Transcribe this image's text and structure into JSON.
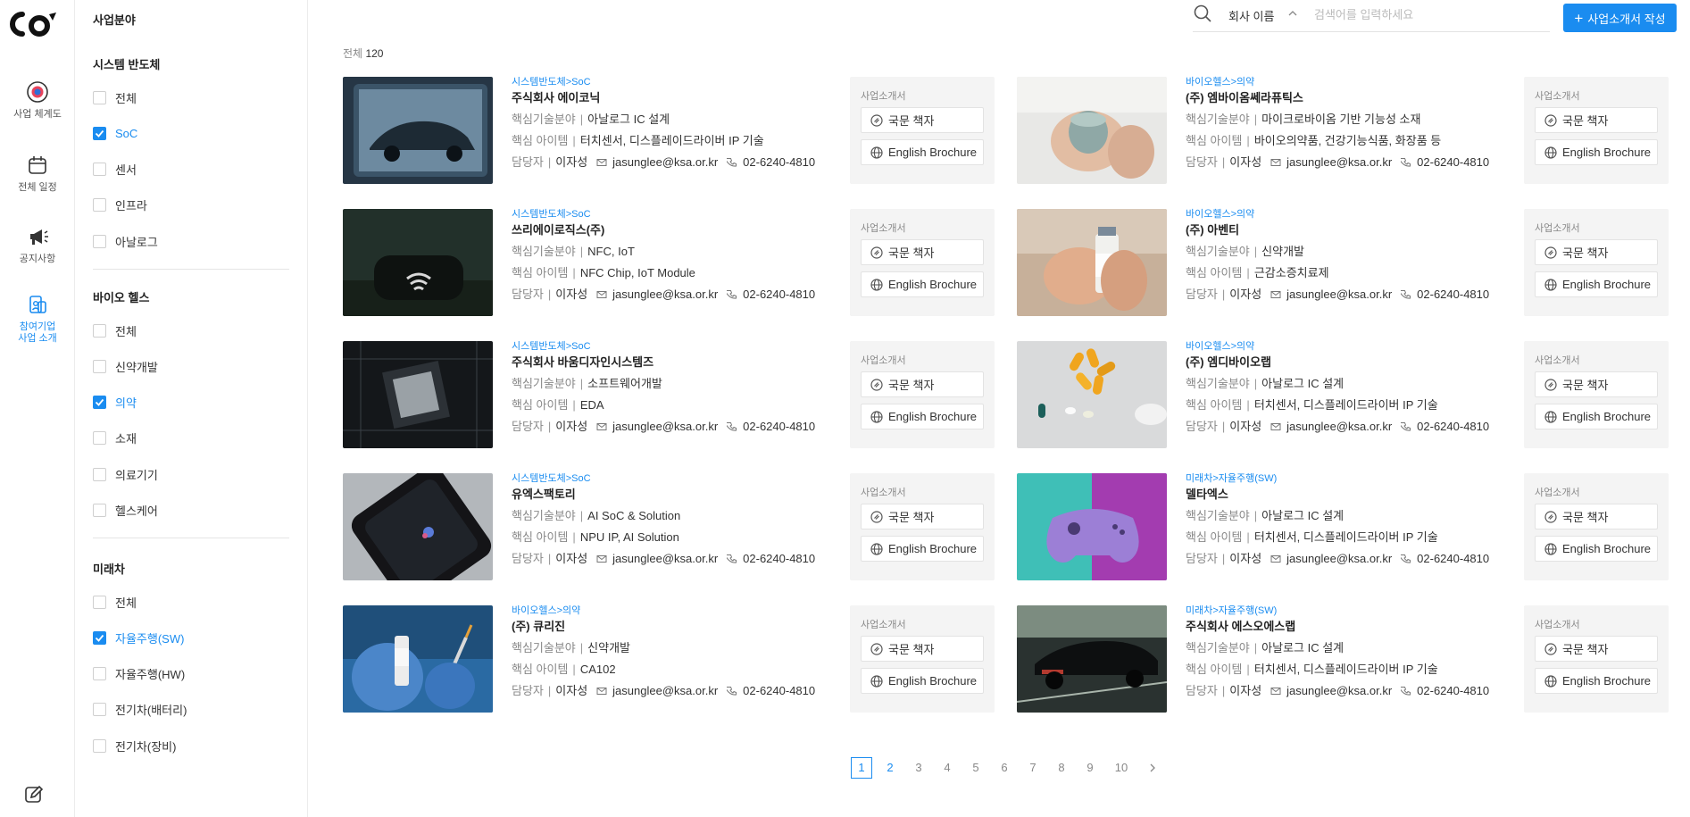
{
  "rail": {
    "items": [
      {
        "label": "사업 체계도",
        "icon": "badge-icon"
      },
      {
        "label": "전체 일정",
        "icon": "calendar-icon"
      },
      {
        "label": "공지사항",
        "icon": "megaphone-icon"
      },
      {
        "label": "참여기업\n사업 소개",
        "icon": "building-icon"
      }
    ],
    "bottom_icon": "edit-icon"
  },
  "filters": {
    "title": "사업분야",
    "groups": [
      {
        "title": "시스템 반도체",
        "items": [
          {
            "label": "전체",
            "checked": false
          },
          {
            "label": "SoC",
            "checked": true
          },
          {
            "label": "센서",
            "checked": false
          },
          {
            "label": "인프라",
            "checked": false
          },
          {
            "label": "아날로그",
            "checked": false
          }
        ]
      },
      {
        "title": "바이오 헬스",
        "items": [
          {
            "label": "전체",
            "checked": false
          },
          {
            "label": "신약개발",
            "checked": false
          },
          {
            "label": "의약",
            "checked": true
          },
          {
            "label": "소재",
            "checked": false
          },
          {
            "label": "의료기기",
            "checked": false
          },
          {
            "label": "헬스케어",
            "checked": false
          }
        ]
      },
      {
        "title": "미래차",
        "items": [
          {
            "label": "전체",
            "checked": false
          },
          {
            "label": "자율주행(SW)",
            "checked": true
          },
          {
            "label": "자율주행(HW)",
            "checked": false
          },
          {
            "label": "전기차(배터리)",
            "checked": false
          },
          {
            "label": "전기차(장비)",
            "checked": false
          }
        ]
      }
    ]
  },
  "search": {
    "field": "회사 이름",
    "placeholder": "검색어를 입력하세요"
  },
  "write_button": "사업소개서 작성",
  "total": {
    "label": "전체",
    "count": "120"
  },
  "labels": {
    "tech": "핵심기술분야",
    "item": "핵심 아이템",
    "manager": "담당자",
    "brochure_title": "사업소개서",
    "korean": "국문 책자",
    "english": "English Brochure"
  },
  "companies": [
    {
      "category": "시스템반도체>SoC",
      "name": "주식회사 에이코닉",
      "tech": "아날로그 IC 설계",
      "item": "터치센서, 디스플레이드라이버 IP 기술",
      "manager": "이자성",
      "email": "jasunglee@ksa.or.kr",
      "phone": "02-6240-4810",
      "thumb": "tablet-car"
    },
    {
      "category": "바이오헬스>의약",
      "name": "(주) 엠바이옴쎄라퓨틱스",
      "tech": "마이크로바이옴 기반 기능성 소재",
      "item": "바이오의약품, 건강기능식품, 화장품 등",
      "manager": "이자성",
      "email": "jasunglee@ksa.or.kr",
      "phone": "02-6240-4810",
      "thumb": "hands-jar"
    },
    {
      "category": "시스템반도체>SoC",
      "name": "쓰리에이로직스(주)",
      "tech": "NFC, IoT",
      "item": "NFC Chip, IoT Module",
      "manager": "이자성",
      "email": "jasunglee@ksa.or.kr",
      "phone": "02-6240-4810",
      "thumb": "nfc"
    },
    {
      "category": "바이오헬스>의약",
      "name": "(주) 아벤티",
      "tech": "신약개발",
      "item": "근감소증치료제",
      "manager": "이자성",
      "email": "jasunglee@ksa.or.kr",
      "phone": "02-6240-4810",
      "thumb": "vial"
    },
    {
      "category": "시스템반도체>SoC",
      "name": "주식회사 바움디자인시스템즈",
      "tech": "소프트웨어개발",
      "item": "EDA",
      "manager": "이자성",
      "email": "jasunglee@ksa.or.kr",
      "phone": "02-6240-4810",
      "thumb": "chip"
    },
    {
      "category": "바이오헬스>의약",
      "name": "(주) 엠디바이오랩",
      "tech": "아날로그 IC 설계",
      "item": "터치센서, 디스플레이드라이버 IP 기술",
      "manager": "이자성",
      "email": "jasunglee@ksa.or.kr",
      "phone": "02-6240-4810",
      "thumb": "pills"
    },
    {
      "category": "시스템반도체>SoC",
      "name": "유엑스팩토리",
      "tech": "AI SoC & Solution",
      "item": "NPU IP, AI Solution",
      "manager": "이자성",
      "email": "jasunglee@ksa.or.kr",
      "phone": "02-6240-4810",
      "thumb": "phone"
    },
    {
      "category": "미래차>자율주행(SW)",
      "name": "델타엑스",
      "tech": "아날로그 IC 설계",
      "item": "터치센서, 디스플레이드라이버 IP 기술",
      "manager": "이자성",
      "email": "jasunglee@ksa.or.kr",
      "phone": "02-6240-4810",
      "thumb": "gamepad"
    },
    {
      "category": "바이오헬스>의약",
      "name": "(주) 큐리진",
      "tech": "신약개발",
      "item": "CA102",
      "manager": "이자성",
      "email": "jasunglee@ksa.or.kr",
      "phone": "02-6240-4810",
      "thumb": "syringe"
    },
    {
      "category": "미래차>자율주행(SW)",
      "name": "주식회사 에스오에스랩",
      "tech": "아날로그 IC 설계",
      "item": "터치센서, 디스플레이드라이버 IP 기술",
      "manager": "이자성",
      "email": "jasunglee@ksa.or.kr",
      "phone": "02-6240-4810",
      "thumb": "car-road"
    }
  ],
  "pagination": {
    "pages": [
      "1",
      "2",
      "3",
      "4",
      "5",
      "6",
      "7",
      "8",
      "9",
      "10"
    ],
    "current": "1",
    "next_icon": "chevron-right-icon"
  },
  "colors": {
    "accent": "#1a8cf0"
  }
}
